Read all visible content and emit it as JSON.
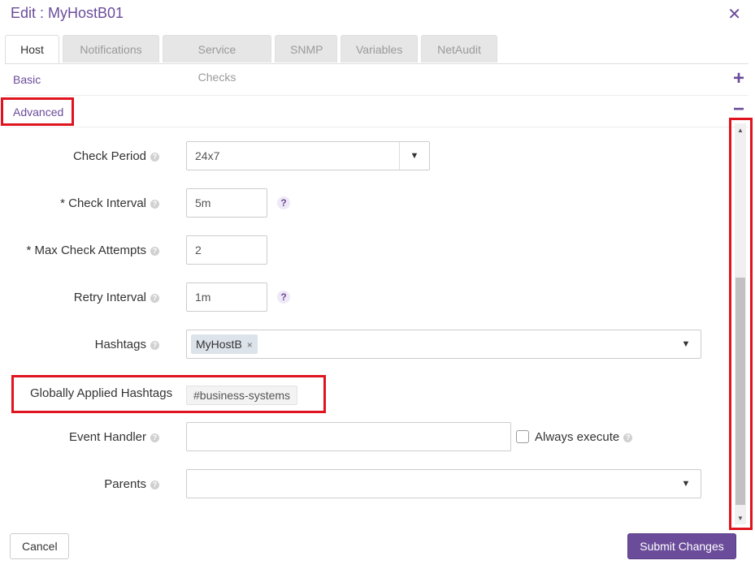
{
  "dialog": {
    "title": "Edit : MyHostB01",
    "close_label": "✕"
  },
  "tabs": [
    {
      "label": "Host",
      "active": true
    },
    {
      "label": "Notifications"
    },
    {
      "label": "Service Checks"
    },
    {
      "label": "SNMP"
    },
    {
      "label": "Variables"
    },
    {
      "label": "NetAudit"
    }
  ],
  "sections": {
    "basic": {
      "label": "Basic",
      "toggle": "+"
    },
    "advanced": {
      "label": "Advanced",
      "toggle": "−"
    }
  },
  "form": {
    "check_period": {
      "label": "Check Period",
      "value": "24x7"
    },
    "check_interval": {
      "label": "* Check Interval",
      "value": "5m"
    },
    "max_check_attempts": {
      "label": "* Max Check Attempts",
      "value": "2"
    },
    "retry_interval": {
      "label": "Retry Interval",
      "value": "1m"
    },
    "hashtags": {
      "label": "Hashtags",
      "chips": [
        "MyHostB"
      ]
    },
    "global_hashtags": {
      "label": "Globally Applied Hashtags",
      "tag": "#business-systems"
    },
    "event_handler": {
      "label": "Event Handler",
      "value": "",
      "always_execute_label": "Always execute"
    },
    "parents": {
      "label": "Parents",
      "value": ""
    }
  },
  "buttons": {
    "cancel": "Cancel",
    "submit": "Submit Changes"
  },
  "colors": {
    "accent": "#6b4c9a",
    "highlight": "#e0141e"
  },
  "icons": {
    "help": "?",
    "dropdown": "▼",
    "chip_remove": "×"
  }
}
